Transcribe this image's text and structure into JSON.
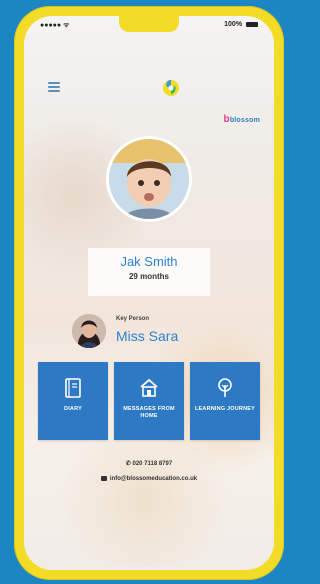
{
  "status": {
    "left": "●●●●● ᯤ",
    "right": "100% "
  },
  "brand": {
    "prefix": "b",
    "text": "blossom"
  },
  "child": {
    "name": "Jak Smith",
    "age": "29 months"
  },
  "key_person": {
    "label": "Key Person",
    "name": "Miss Sara"
  },
  "tiles": [
    {
      "label": "DIARY",
      "icon": "diary-icon"
    },
    {
      "label": "MESSAGES FROM HOME",
      "icon": "home-icon"
    },
    {
      "label": "LEARNING JOURNEY",
      "icon": "tree-icon"
    }
  ],
  "contact": {
    "phone": "020 7118 8797",
    "email": "info@blossomeducation.co.uk"
  },
  "colors": {
    "tile": "#2e79c4",
    "frame": "#f3dc27",
    "background": "#1c86c2",
    "accent": "#2f7fd0"
  }
}
